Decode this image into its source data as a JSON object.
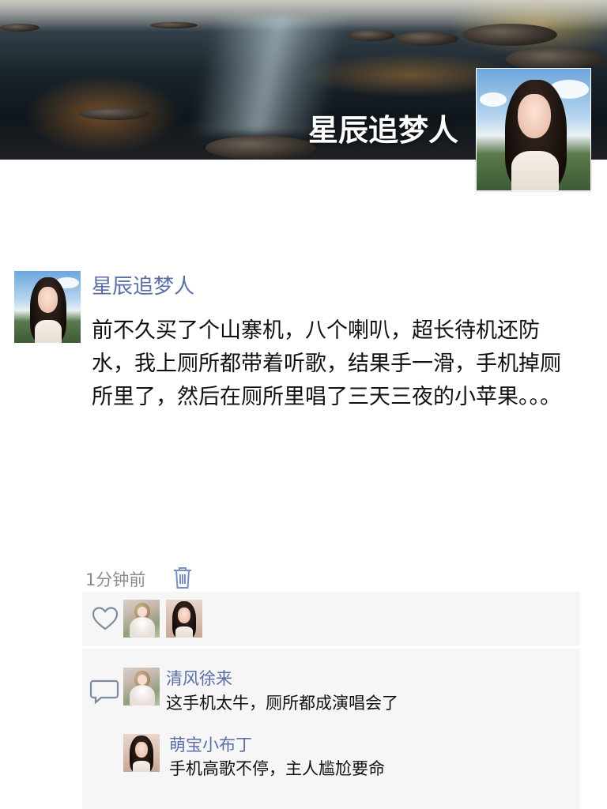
{
  "cover": {
    "username": "星辰追梦人"
  },
  "post": {
    "author": "星辰追梦人",
    "content": "前不久买了个山寨机，八个喇叭，超长待机还防水，我上厕所都带着听歌，结果手一滑，手机掉厕所里了，然后在厕所里唱了三天三夜的小苹果。。。",
    "time": "1分钟前",
    "icons": {
      "delete": "trash-icon",
      "like": "heart-icon",
      "comment": "comment-icon"
    },
    "likes": [
      "fairy-avatar",
      "portrait-avatar"
    ],
    "comments": [
      {
        "name": "清风徐来",
        "text": "这手机太牛，厕所都成演唱会了"
      },
      {
        "name": "萌宝小布丁",
        "text": "手机高歌不停，主人尴尬要命"
      }
    ]
  },
  "colors": {
    "name_link": "#5b6fa6",
    "time": "#8c8c8c",
    "panel_bg": "#f6f6f6",
    "icon_blue": "#7a8fc4"
  }
}
